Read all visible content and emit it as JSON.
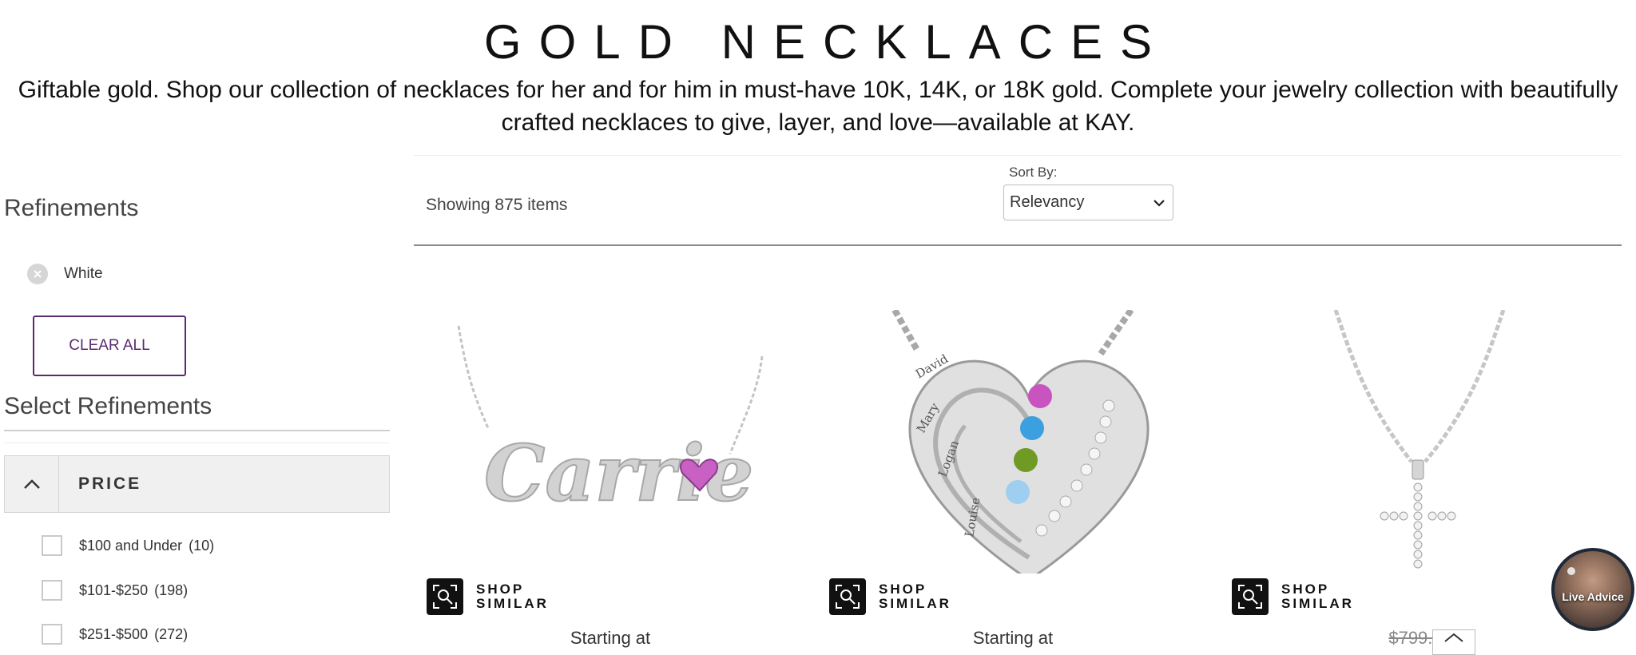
{
  "header": {
    "title": "GOLD NECKLACES",
    "description": "Giftable gold. Shop our collection of necklaces for her and for him in must-have 10K, 14K, or 18K gold. Complete your jewelry collection with beautifully crafted necklaces to give, layer, and love—available at KAY."
  },
  "sidebar": {
    "refinements_heading": "Refinements",
    "active_filter": "White",
    "clear_all_label": "CLEAR ALL",
    "select_heading": "Select Refinements",
    "price_section": {
      "label": "PRICE",
      "options": [
        {
          "label": "$100 and Under",
          "count": "(10)"
        },
        {
          "label": "$101-$250",
          "count": "(198)"
        },
        {
          "label": "$251-$500",
          "count": "(272)"
        }
      ]
    }
  },
  "results": {
    "showing_text": "Showing 875 items",
    "sort_label": "Sort By:",
    "sort_value": "Relevancy"
  },
  "products": [
    {
      "shop_similar_1": "SHOP",
      "shop_similar_2": "SIMILAR",
      "price_text": "Starting at",
      "name_on_necklace": "Carrie"
    },
    {
      "shop_similar_1": "SHOP",
      "shop_similar_2": "SIMILAR",
      "price_text": "Starting at",
      "engravings": [
        "David",
        "Mary",
        "Logan",
        "Louise"
      ]
    },
    {
      "shop_similar_1": "SHOP",
      "shop_similar_2": "SIMILAR",
      "price_text": "$799.9"
    }
  ],
  "live_advice_label": "Live Advice",
  "colors": {
    "brand_purple": "#5a2a6e",
    "text_dark": "#111111",
    "silver": "#cfcfcf"
  },
  "icons": {
    "remove_filter": "close-circle-icon",
    "price_toggle": "chevron-up-icon",
    "sort_arrow": "chevron-down-icon",
    "shop_similar": "visual-search-icon",
    "scroll_top": "chevron-up-icon"
  }
}
